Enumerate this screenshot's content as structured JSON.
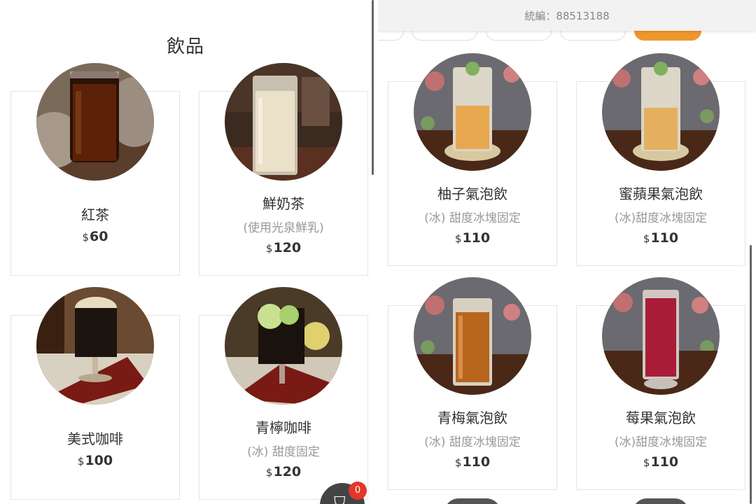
{
  "left_panel": {
    "title": "飲品",
    "items": [
      {
        "name": "紅茶",
        "note": "",
        "currency": "$",
        "price": "60"
      },
      {
        "name": "鮮奶茶",
        "note": "(使用光泉鮮乳)",
        "currency": "$",
        "price": "120"
      },
      {
        "name": "美式咖啡",
        "note": "",
        "currency": "$",
        "price": "100"
      },
      {
        "name": "青檸咖啡",
        "note": "(冰) 甜度固定",
        "currency": "$",
        "price": "120"
      }
    ]
  },
  "cart": {
    "count": "0",
    "icon": "cart-icon"
  },
  "right_panel": {
    "tax_id": "統編：88513188",
    "items": [
      {
        "name": "柚子氣泡飲",
        "note": "(冰) 甜度冰塊固定",
        "currency": "$",
        "price": "110"
      },
      {
        "name": "蜜蘋果氣泡飲",
        "note": "(冰)甜度冰塊固定",
        "currency": "$",
        "price": "110"
      },
      {
        "name": "青梅氣泡飲",
        "note": "(冰) 甜度冰塊固定",
        "currency": "$",
        "price": "110"
      },
      {
        "name": "莓果氣泡飲",
        "note": "(冰)甜度冰塊固定",
        "currency": "$",
        "price": "110"
      }
    ]
  },
  "colors": {
    "accent": "#f0962e",
    "badge": "#e2372b",
    "cart_button": "#444444"
  }
}
